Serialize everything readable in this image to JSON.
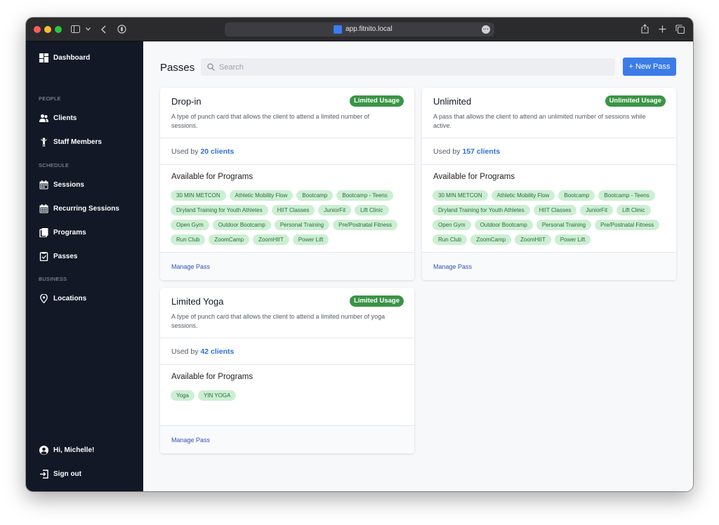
{
  "browser": {
    "url": "app.fitnito.local"
  },
  "sidebar": {
    "items": [
      {
        "label": "Dashboard",
        "icon": "dashboard-icon"
      },
      {
        "section": "PEOPLE"
      },
      {
        "label": "Clients",
        "icon": "users-icon"
      },
      {
        "label": "Staff Members",
        "icon": "staff-icon"
      },
      {
        "section": "SCHEDULE"
      },
      {
        "label": "Sessions",
        "icon": "calendar-icon"
      },
      {
        "label": "Recurring Sessions",
        "icon": "calendar-repeat-icon"
      },
      {
        "label": "Programs",
        "icon": "clipboard-icon"
      },
      {
        "label": "Passes",
        "icon": "pass-icon"
      },
      {
        "section": "BUSINESS"
      },
      {
        "label": "Locations",
        "icon": "location-icon"
      }
    ],
    "user_label": "Hi, Michelle!",
    "signout_label": "Sign out"
  },
  "header": {
    "title": "Passes",
    "search_placeholder": "Search",
    "new_button": "+ New Pass"
  },
  "passes": [
    {
      "name": "Drop-in",
      "badge": "Limited Usage",
      "description": "A type of punch card that allows the client to attend a limited number of sessions.",
      "used_prefix": "Used by",
      "used_count": "20 clients",
      "programs_heading": "Available for Programs",
      "programs": [
        "30 MIN METCON",
        "Athletic Mobility Flow",
        "Bootcamp",
        "Bootcamp - Teens",
        "Dryland Training for Youth Athletes",
        "HIIT Classes",
        "JuniorFit",
        "Lift Clinic",
        "Open Gym",
        "Outdoor Bootcamp",
        "Personal Training",
        "Pre/Postnatal Fitness",
        "Run Club",
        "ZoomCamp",
        "ZoomHIIT",
        "Power Lift"
      ],
      "manage_label": "Manage Pass"
    },
    {
      "name": "Unlimited",
      "badge": "Unlimited Usage",
      "description": "A pass that allows the client to attend an unlimited number of sessions while active.",
      "used_prefix": "Used by",
      "used_count": "157 clients",
      "programs_heading": "Available for Programs",
      "programs": [
        "30 MIN METCON",
        "Athletic Mobility Flow",
        "Bootcamp",
        "Bootcamp - Teens",
        "Dryland Training for Youth Athletes",
        "HIIT Classes",
        "JuniorFit",
        "Lift Clinic",
        "Open Gym",
        "Outdoor Bootcamp",
        "Personal Training",
        "Pre/Postnatal Fitness",
        "Run Club",
        "ZoomCamp",
        "ZoomHIIT",
        "Power Lift"
      ],
      "manage_label": "Manage Pass"
    },
    {
      "name": "Limited Yoga",
      "badge": "Limited Usage",
      "description": "A type of punch card that allows the client to attend a limited number of yoga sessions.",
      "used_prefix": "Used by",
      "used_count": "42 clients",
      "programs_heading": "Available for Programs",
      "programs": [
        "Yoga",
        "YIN YOGA"
      ],
      "manage_label": "Manage Pass"
    }
  ],
  "colors": {
    "sidebar_bg": "#121826",
    "accent_blue": "#3b7ce9",
    "badge_green": "#3a9446",
    "tag_bg": "#ccefd3"
  }
}
